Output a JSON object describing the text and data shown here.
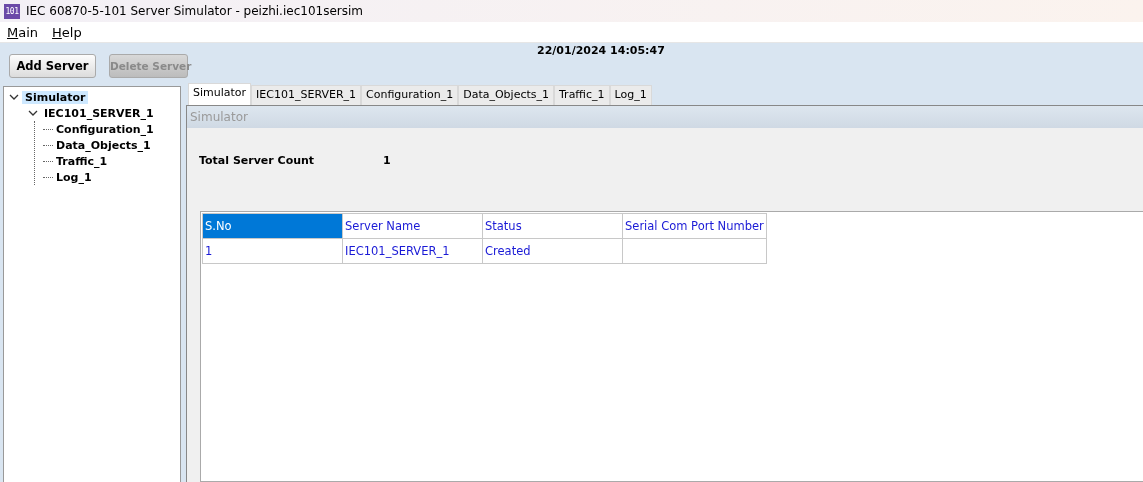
{
  "window": {
    "icon_text": "101",
    "title": "IEC 60870-5-101 Server Simulator - peizhi.iec101sersim"
  },
  "menu": [
    "Main",
    "Help"
  ],
  "toolbar": {
    "buttons": [
      {
        "label": "Add Server",
        "disabled": false
      },
      {
        "label": "Delete Server",
        "disabled": true
      }
    ],
    "datetime": "22/01/2024 14:05:47"
  },
  "tree": [
    {
      "label": "Simulator",
      "selected": true,
      "expanded": true,
      "children": [
        {
          "label": "IEC101_SERVER_1",
          "selected": false,
          "expanded": true,
          "children": [
            {
              "label": "Configuration_1",
              "selected": false
            },
            {
              "label": "Data_Objects_1",
              "selected": false
            },
            {
              "label": "Traffic_1",
              "selected": false
            },
            {
              "label": "Log_1",
              "selected": false
            }
          ]
        }
      ]
    }
  ],
  "tabs": [
    {
      "label": "Simulator",
      "selected": true
    },
    {
      "label": "IEC101_SERVER_1",
      "selected": false
    },
    {
      "label": "Configuration_1",
      "selected": false
    },
    {
      "label": "Data_Objects_1",
      "selected": false
    },
    {
      "label": "Traffic_1",
      "selected": false
    },
    {
      "label": "Log_1",
      "selected": false
    }
  ],
  "panel": {
    "title": "Simulator",
    "summary_label": "Total Server Count",
    "summary_value": "1"
  },
  "table": {
    "columns": [
      {
        "label": "S.No",
        "selected": true
      },
      {
        "label": "Server Name",
        "selected": false
      },
      {
        "label": "Status",
        "selected": false
      },
      {
        "label": "Serial Com Port Number",
        "selected": false
      }
    ],
    "rows": [
      [
        "1",
        "IEC101_SERVER_1",
        "Created",
        ""
      ]
    ]
  }
}
